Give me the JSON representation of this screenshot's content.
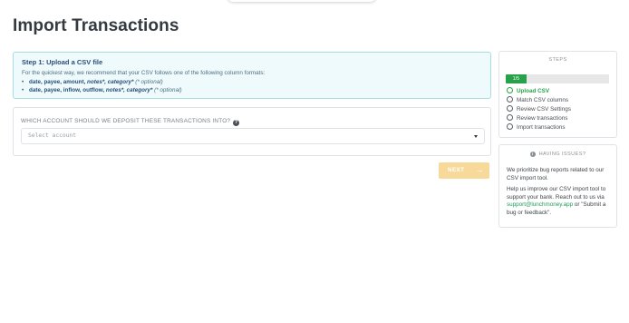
{
  "page": {
    "title": "Import Transactions"
  },
  "step_info": {
    "title": "Step 1: Upload a CSV file",
    "description": "For the quickest way, we recommend that your CSV follows one of the following column formats:",
    "formats": [
      {
        "bullet": "•",
        "columns": "date, payee, amount,",
        "italic_cols": "notes*, category*",
        "optional": "(* optional)"
      },
      {
        "bullet": "•",
        "columns": "date, payee, inflow, outflow,",
        "italic_cols": "notes*, category*",
        "optional": "(* optional)"
      }
    ]
  },
  "account": {
    "question": "WHICH ACCOUNT SHOULD WE DEPOSIT THESE TRANSACTIONS INTO?",
    "help_glyph": "?",
    "select_placeholder": "Select account"
  },
  "next_button": {
    "label": "NEXT",
    "arrow": "→"
  },
  "steps_panel": {
    "header": "STEPS",
    "progress_label": "1/5",
    "progress_fraction": 0.2,
    "accent_color": "#27a24a",
    "items": [
      {
        "label": "Upload CSV",
        "active": true
      },
      {
        "label": "Match CSV columns",
        "active": false
      },
      {
        "label": "Review CSV Settings",
        "active": false
      },
      {
        "label": "Review transactions",
        "active": false
      },
      {
        "label": "Import transactions",
        "active": false
      }
    ]
  },
  "issues_panel": {
    "header": "HAVING ISSUES?",
    "icon_glyph": "i",
    "para1": "We prioritize bug reports related to our CSV import tool.",
    "para2_pre": "Help us improve our CSV import tool to support your bank. Reach out to us via ",
    "email": "support@lunchmoney.app",
    "para2_post": " or \"Submit a bug or feedback\"."
  }
}
